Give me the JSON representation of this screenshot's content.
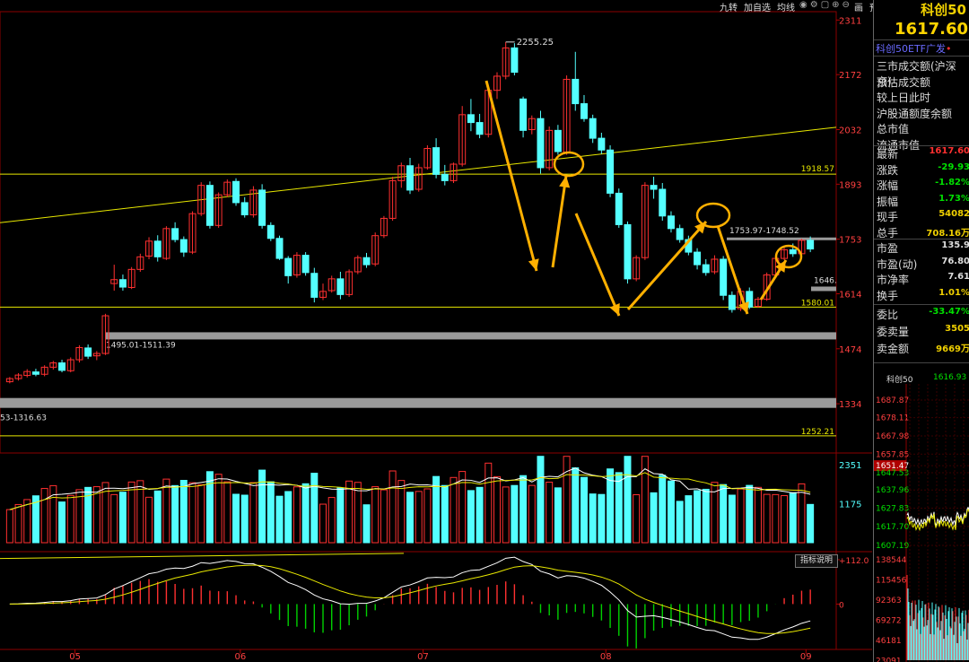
{
  "toolbar": {
    "items": [
      "九转",
      "加自选",
      "均线",
      "画",
      "预测"
    ],
    "icons": [
      "eye-icon",
      "settings-icon",
      "copy-icon",
      "zoom-in-icon",
      "zoom-out-icon"
    ]
  },
  "chart_data": [
    {
      "type": "candlestick",
      "title": "",
      "ylim": [
        1220,
        2330
      ],
      "y_ticks": [
        "2311",
        "2172",
        "2032",
        "1893",
        "1753",
        "1614",
        "1474",
        "1334"
      ],
      "x_ticks": [
        "05",
        "06",
        "07",
        "08",
        "09"
      ],
      "price_lines": [
        {
          "label": "1918.57",
          "value": 1918.57,
          "color": "#e8e800"
        },
        {
          "label": "1580.01",
          "value": 1580.01,
          "color": "#e8e800"
        },
        {
          "label": "1252.21",
          "value": 1252.21,
          "color": "#e8e800"
        }
      ],
      "gap_bands": [
        {
          "label": "1495.01-1511.39",
          "low": 1495.01,
          "high": 1511.39
        },
        {
          "label": "53-1316.63",
          "low": 1290,
          "high": 1316.63
        },
        {
          "label": "1753.97-1748.52",
          "low": 1748.52,
          "high": 1753.97
        },
        {
          "label": "1646.",
          "low": 1636,
          "high": 1646
        }
      ],
      "peak_label": "2255.25",
      "trendline": {
        "x": [
          "04-20",
          "09-01"
        ],
        "y": [
          1795,
          2038
        ]
      },
      "x_range": [
        "04-19",
        "09-01"
      ],
      "candles": [
        [
          "04-20",
          1390,
          1402,
          1386,
          1398
        ],
        [
          "04-21",
          1398,
          1412,
          1393,
          1407
        ],
        [
          "04-22",
          1406,
          1422,
          1401,
          1416
        ],
        [
          "04-25",
          1415,
          1423,
          1404,
          1409
        ],
        [
          "04-26",
          1409,
          1432,
          1404,
          1427
        ],
        [
          "04-27",
          1427,
          1443,
          1421,
          1438
        ],
        [
          "04-28",
          1438,
          1446,
          1414,
          1419
        ],
        [
          "04-29",
          1418,
          1452,
          1414,
          1446
        ],
        [
          "05-05",
          1446,
          1483,
          1439,
          1477
        ],
        [
          "05-06",
          1476,
          1485,
          1448,
          1455
        ],
        [
          "05-09",
          1456,
          1468,
          1445,
          1462
        ],
        [
          "05-10",
          1462,
          1563,
          1458,
          1558
        ],
        [
          "05-11",
          1640,
          1688,
          1622,
          1650
        ],
        [
          "05-12",
          1650,
          1663,
          1622,
          1631
        ],
        [
          "05-13",
          1630,
          1682,
          1626,
          1676
        ],
        [
          "05-16",
          1676,
          1716,
          1670,
          1708
        ],
        [
          "05-17",
          1710,
          1758,
          1702,
          1748
        ],
        [
          "05-18",
          1748,
          1763,
          1696,
          1708
        ],
        [
          "05-19",
          1704,
          1786,
          1700,
          1780
        ],
        [
          "05-20",
          1780,
          1796,
          1745,
          1752
        ],
        [
          "05-23",
          1752,
          1760,
          1708,
          1720
        ],
        [
          "05-24",
          1720,
          1824,
          1715,
          1818
        ],
        [
          "05-25",
          1818,
          1898,
          1812,
          1890
        ],
        [
          "05-26",
          1890,
          1900,
          1780,
          1788
        ],
        [
          "05-27",
          1788,
          1872,
          1782,
          1866
        ],
        [
          "05-30",
          1866,
          1905,
          1860,
          1898
        ],
        [
          "05-31",
          1900,
          1908,
          1838,
          1846
        ],
        [
          "06-01",
          1846,
          1860,
          1808,
          1815
        ],
        [
          "06-02",
          1815,
          1888,
          1808,
          1878
        ],
        [
          "06-06",
          1878,
          1893,
          1780,
          1788
        ],
        [
          "06-07",
          1788,
          1796,
          1748,
          1755
        ],
        [
          "06-08",
          1755,
          1762,
          1700,
          1704
        ],
        [
          "06-09",
          1704,
          1710,
          1640,
          1660
        ],
        [
          "06-10",
          1662,
          1720,
          1655,
          1712
        ],
        [
          "06-13",
          1712,
          1720,
          1660,
          1668
        ],
        [
          "06-14",
          1666,
          1680,
          1592,
          1605
        ],
        [
          "06-15",
          1605,
          1640,
          1598,
          1620
        ],
        [
          "06-16",
          1622,
          1660,
          1617,
          1652
        ],
        [
          "06-17",
          1652,
          1670,
          1600,
          1612
        ],
        [
          "06-20",
          1612,
          1676,
          1606,
          1670
        ],
        [
          "06-21",
          1670,
          1712,
          1664,
          1706
        ],
        [
          "06-22",
          1706,
          1718,
          1680,
          1688
        ],
        [
          "06-23",
          1690,
          1770,
          1684,
          1762
        ],
        [
          "06-24",
          1762,
          1812,
          1756,
          1806
        ],
        [
          "06-27",
          1806,
          1912,
          1800,
          1902
        ],
        [
          "06-28",
          1902,
          1948,
          1884,
          1940
        ],
        [
          "06-29",
          1940,
          1960,
          1868,
          1878
        ],
        [
          "06-30",
          1880,
          1945,
          1874,
          1935
        ],
        [
          "07-01",
          1935,
          1992,
          1930,
          1984
        ],
        [
          "07-04",
          1986,
          2010,
          1908,
          1918
        ],
        [
          "07-05",
          1918,
          1942,
          1890,
          1902
        ],
        [
          "07-06",
          1902,
          1948,
          1896,
          1944
        ],
        [
          "07-07",
          1944,
          2092,
          1938,
          2070
        ],
        [
          "07-08",
          2070,
          2110,
          2028,
          2050
        ],
        [
          "07-11",
          2050,
          2072,
          2010,
          2020
        ],
        [
          "07-12",
          2020,
          2140,
          2012,
          2132
        ],
        [
          "07-13",
          2132,
          2178,
          2110,
          2168
        ],
        [
          "07-14",
          2168,
          2255,
          2160,
          2240
        ],
        [
          "07-15",
          2240,
          2252,
          2170,
          2178
        ],
        [
          "07-18",
          2110,
          2116,
          2012,
          2030
        ],
        [
          "07-19",
          2032,
          2068,
          2020,
          2060
        ],
        [
          "07-20",
          2060,
          2080,
          1920,
          1935
        ],
        [
          "07-21",
          1935,
          2040,
          1928,
          2030
        ],
        [
          "07-22",
          2030,
          2044,
          1968,
          1976
        ],
        [
          "07-25",
          1975,
          2170,
          1968,
          2160
        ],
        [
          "07-26",
          2160,
          2230,
          2080,
          2098
        ],
        [
          "07-27",
          2098,
          2120,
          2052,
          2060
        ],
        [
          "07-28",
          2060,
          2070,
          1998,
          2010
        ],
        [
          "07-29",
          2010,
          2024,
          1970,
          1980
        ],
        [
          "08-01",
          1980,
          1992,
          1860,
          1870
        ],
        [
          "08-02",
          1870,
          1882,
          1782,
          1790
        ],
        [
          "08-03",
          1790,
          1798,
          1640,
          1652
        ],
        [
          "08-04",
          1652,
          1712,
          1646,
          1706
        ],
        [
          "08-05",
          1706,
          1898,
          1700,
          1890
        ],
        [
          "08-08",
          1890,
          1912,
          1856,
          1880
        ],
        [
          "08-09",
          1880,
          1896,
          1800,
          1812
        ],
        [
          "08-10",
          1812,
          1824,
          1770,
          1780
        ],
        [
          "08-11",
          1780,
          1790,
          1744,
          1752
        ],
        [
          "08-12",
          1752,
          1762,
          1712,
          1720
        ],
        [
          "08-15",
          1720,
          1730,
          1676,
          1688
        ],
        [
          "08-16",
          1688,
          1702,
          1660,
          1668
        ],
        [
          "08-17",
          1670,
          1712,
          1664,
          1702
        ],
        [
          "08-18",
          1702,
          1710,
          1598,
          1610
        ],
        [
          "08-19",
          1610,
          1620,
          1566,
          1574
        ],
        [
          "08-22",
          1576,
          1628,
          1570,
          1620
        ],
        [
          "08-23",
          1620,
          1630,
          1575,
          1580
        ],
        [
          "08-24",
          1582,
          1606,
          1578,
          1600
        ],
        [
          "08-25",
          1600,
          1668,
          1596,
          1662
        ],
        [
          "08-26",
          1662,
          1712,
          1656,
          1704
        ],
        [
          "08-29",
          1704,
          1734,
          1700,
          1726
        ],
        [
          "08-30",
          1726,
          1742,
          1708,
          1716
        ],
        [
          "08-31",
          1716,
          1754,
          1712,
          1750
        ],
        [
          "09-01",
          1750,
          1760,
          1720,
          1728
        ]
      ]
    },
    {
      "type": "bar",
      "title": "volume",
      "y_ticks": [
        "2351",
        "1175"
      ],
      "ylim": [
        0,
        2700
      ],
      "ma_series": [
        "MA5",
        "MA10"
      ]
    },
    {
      "type": "macd",
      "y_ticks": [
        "112.0",
        "0"
      ],
      "ylim": [
        -110,
        130
      ]
    },
    {
      "type": "line",
      "title": "科创50",
      "value_label": "1616.93",
      "y_ticks": [
        "1687.87",
        "1678.11",
        "1667.98",
        "1657.85",
        "1651.47",
        "1647.53",
        "1637.96",
        "1627.83",
        "1617.70",
        "1607.19"
      ],
      "volume_ticks": [
        "138544",
        "115456",
        "92363",
        "69272",
        "46181",
        "23091"
      ]
    }
  ],
  "panel": {
    "name": "科创50",
    "price": "1617.60",
    "etf": "科创50ETF广发",
    "rows_a": [
      "三市成交额(沪深京)",
      "预估成交额",
      "较上日此时",
      "沪股通额度余额",
      "总市值",
      "流通市值"
    ],
    "rows_b": [
      {
        "k": "最新",
        "v": "1617.60",
        "c": "red"
      },
      {
        "k": "涨跌",
        "v": "-29.93",
        "c": "green"
      },
      {
        "k": "涨幅",
        "v": "-1.82%",
        "c": "green"
      },
      {
        "k": "振幅",
        "v": "1.73%",
        "c": "green"
      },
      {
        "k": "现手",
        "v": "54082",
        "c": "yellow"
      },
      {
        "k": "总手",
        "v": "708.16万",
        "c": "yellow"
      }
    ],
    "rows_c": [
      {
        "k": "市盈",
        "v": "135.9",
        "c": "white"
      },
      {
        "k": "市盈(动)",
        "v": "76.80",
        "c": "white"
      },
      {
        "k": "市净率",
        "v": "7.61",
        "c": "white"
      },
      {
        "k": "换手",
        "v": "1.01%",
        "c": "yellow"
      }
    ],
    "rows_d": [
      {
        "k": "委比",
        "v": "-33.47%",
        "c": "green"
      },
      {
        "k": "委卖量",
        "v": "3505",
        "c": "yellow"
      },
      {
        "k": "卖金额",
        "v": "9669万",
        "c": "yellow"
      }
    ]
  },
  "indicator_button": "指标说明"
}
